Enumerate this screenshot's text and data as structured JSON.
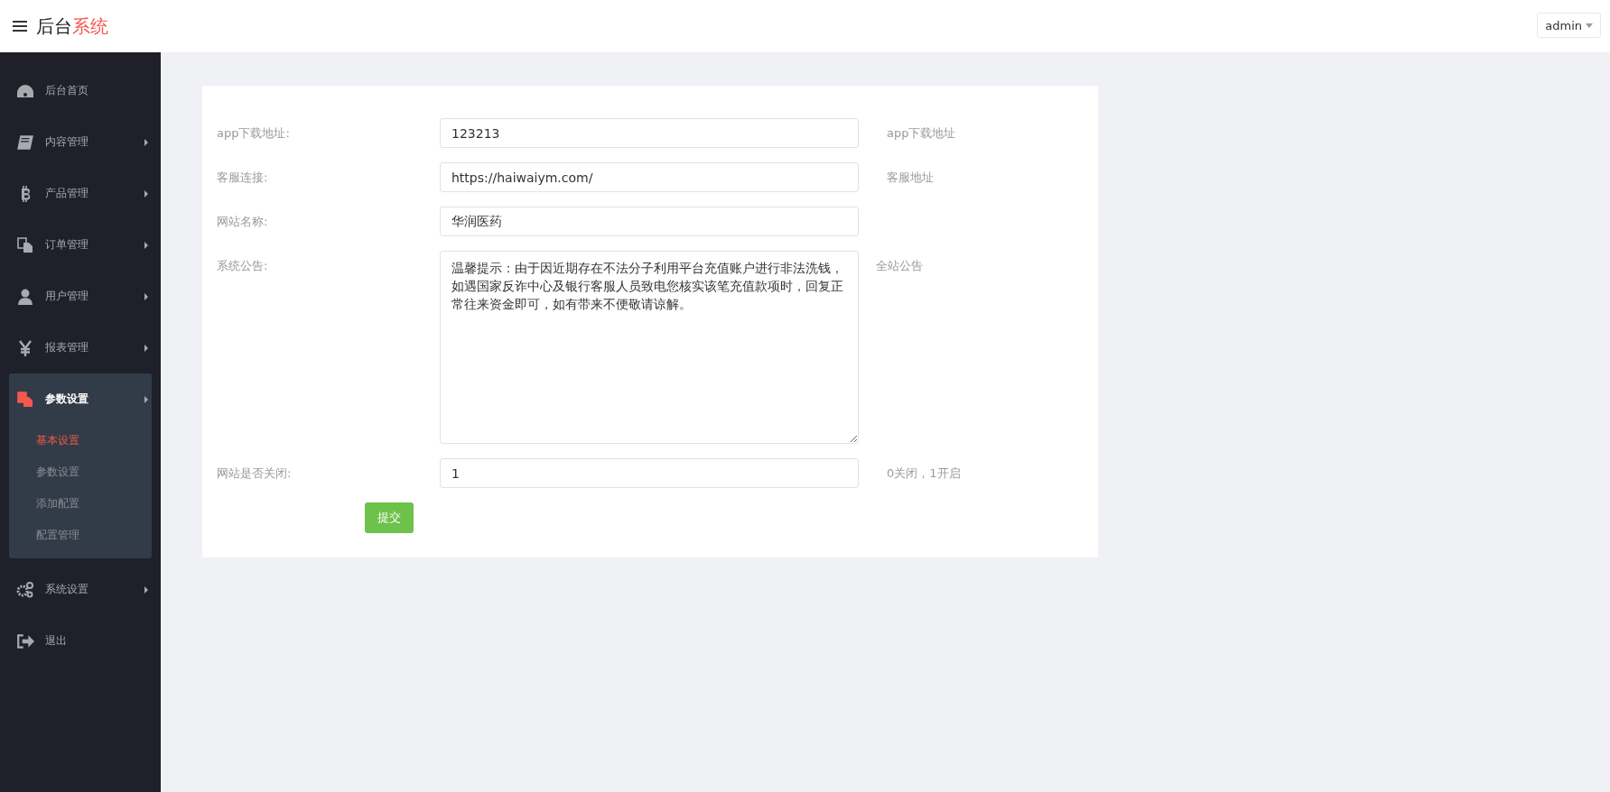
{
  "header": {
    "title_main": "后台",
    "title_accent": "系统",
    "user": "admin"
  },
  "sidebar": {
    "items": [
      {
        "label": "后台首页",
        "kind": "dashboard",
        "expandable": false,
        "expanded": false,
        "selected": false
      },
      {
        "label": "内容管理",
        "kind": "book",
        "expandable": true,
        "expanded": false,
        "selected": false
      },
      {
        "label": "产品管理",
        "kind": "bitcoin",
        "expandable": true,
        "expanded": false,
        "selected": false
      },
      {
        "label": "订单管理",
        "kind": "files",
        "expandable": true,
        "expanded": false,
        "selected": false
      },
      {
        "label": "用户管理",
        "kind": "user",
        "expandable": true,
        "expanded": false,
        "selected": false
      },
      {
        "label": "报表管理",
        "kind": "yen",
        "expandable": true,
        "expanded": false,
        "selected": false
      },
      {
        "label": "参数设置",
        "kind": "files",
        "expandable": true,
        "expanded": true,
        "selected": true,
        "children": [
          {
            "label": "基本设置",
            "selected": true
          },
          {
            "label": "参数设置",
            "selected": false
          },
          {
            "label": "添加配置",
            "selected": false
          },
          {
            "label": "配置管理",
            "selected": false
          }
        ]
      },
      {
        "label": "系统设置",
        "kind": "gears",
        "expandable": true,
        "expanded": false,
        "selected": false
      },
      {
        "label": "退出",
        "kind": "logout",
        "expandable": false,
        "expanded": false,
        "selected": false
      }
    ]
  },
  "form": {
    "fields": [
      {
        "label": "app下载地址:",
        "kind": "input",
        "value": "123213",
        "hint": "app下载地址"
      },
      {
        "label": "客服连接:",
        "kind": "input",
        "value": "https://haiwaiym.com/",
        "hint": "客服地址"
      },
      {
        "label": "网站名称:",
        "kind": "input",
        "value": "华润医药"
      },
      {
        "label": "系统公告:",
        "kind": "textarea",
        "value": "温馨提示：由于因近期存在不法分子利用平台充值账户进行非法洗钱，如遇国家反诈中心及银行客服人员致电您核实该笔充值款项时，回复正常往来资金即可，如有带来不便敬请谅解。",
        "hint": "全站公告"
      },
      {
        "label": "网站是否关闭:",
        "kind": "input",
        "value": "1",
        "hint": "0关闭，1开启"
      }
    ],
    "submit": "提交"
  }
}
